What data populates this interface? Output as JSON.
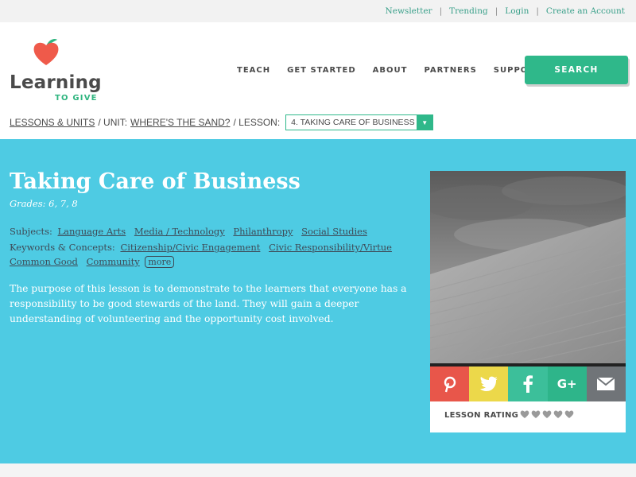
{
  "topbar": {
    "links": [
      "Newsletter",
      "Trending",
      "Login",
      "Create an Account"
    ],
    "separator": "|"
  },
  "header": {
    "logo": {
      "word": "Learning",
      "sub": "TO GIVE"
    },
    "nav": [
      "TEACH",
      "GET STARTED",
      "ABOUT",
      "PARTNERS",
      "SUPPORT US"
    ],
    "search_label": "SEARCH"
  },
  "breadcrumb": {
    "lessons_units": "LESSONS & UNITS",
    "unit_prefix": "/ UNIT:",
    "unit_name": "WHERE'S THE SAND?",
    "lesson_prefix": "/ LESSON:",
    "lesson_selected": "4. TAKING CARE OF BUSINESS"
  },
  "lesson": {
    "title": "Taking Care of Business",
    "grades": "Grades: 6, 7, 8",
    "subjects_label": "Subjects:",
    "subjects": [
      "Language Arts",
      "Media / Technology",
      "Philanthropy",
      "Social Studies"
    ],
    "keywords_label": "Keywords & Concepts:",
    "keywords": [
      "Citizenship/Civic Engagement",
      "Civic Responsibility/Virtue",
      "Common Good",
      "Community"
    ],
    "more_label": "more",
    "description": "The purpose of this lesson is to demonstrate to the learners that everyone has a responsibility to be good stewards of the land. They will gain a deeper understanding of volunteering and the opportunity cost involved."
  },
  "share": {
    "buttons": [
      {
        "name": "pinterest-icon",
        "glyph": "P",
        "color": "#e8564a"
      },
      {
        "name": "twitter-icon",
        "glyph": "🐦",
        "color": "#e8d34a"
      },
      {
        "name": "facebook-icon",
        "glyph": "f",
        "color": "#3cbf9a"
      },
      {
        "name": "google-plus-icon",
        "glyph": "G+",
        "color": "#2eb58a"
      },
      {
        "name": "email-icon",
        "glyph": "✉",
        "color": "#707478"
      }
    ]
  },
  "rating": {
    "label": "LESSON RATING",
    "hearts": 5,
    "filled": 0
  },
  "colors": {
    "accent": "#2fb88a",
    "hero": "#4ecbe3",
    "link": "#3aa08a"
  }
}
